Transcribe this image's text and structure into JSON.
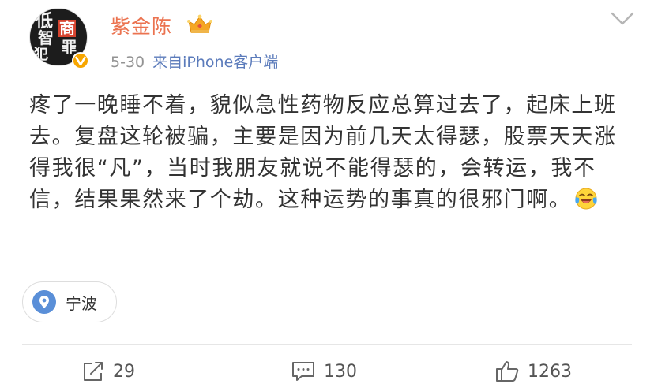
{
  "post": {
    "author": {
      "name": "紫金陈",
      "avatar_text": [
        "低",
        "智",
        "商",
        "犯",
        "罪"
      ]
    },
    "meta": {
      "date": "5-30",
      "source": "来自iPhone客户端"
    },
    "text": "疼了一晚睡不着，貌似急性药物反应总算过去了，起床上班去。复盘这轮被骗，主要是因为前几天太得瑟，股票天天涨得我很“凡”，当时我朋友就说不能得瑟的，会转运，我不信，结果果然来了个劫。这种运势的事真的很邪门啊。",
    "emoji": "laughing-crying-face",
    "location": "宁波",
    "actions": {
      "repost_count": "29",
      "comment_count": "130",
      "like_count": "1263"
    }
  },
  "colors": {
    "author_name": "#eb7350",
    "meta_gray": "#939393",
    "source_link": "#5b7bbb",
    "location_pin": "#5a8fd8",
    "verified_badge": "#f7a600"
  }
}
